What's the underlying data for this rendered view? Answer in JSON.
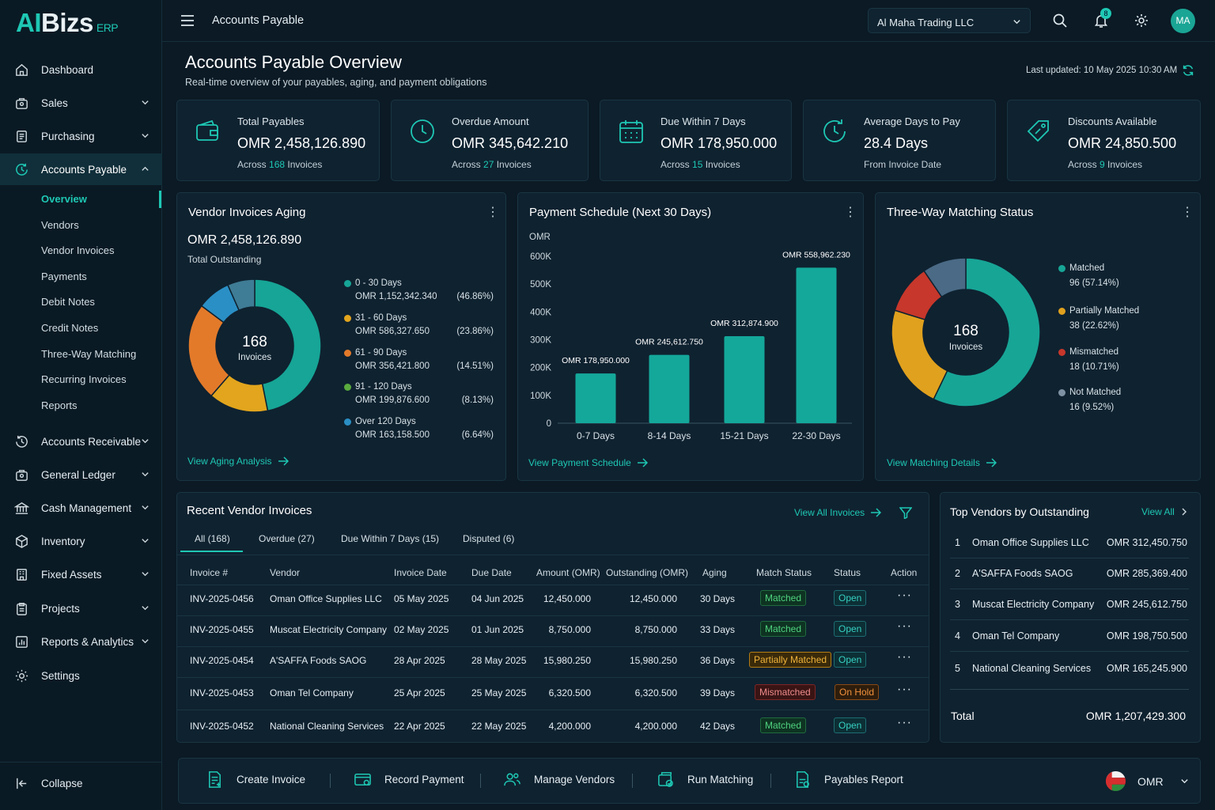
{
  "brand": {
    "logo_ai": "AI",
    "logo_biz": "Bizs",
    "logo_erp": "ERP"
  },
  "sidebar": {
    "items": [
      {
        "label": "Dashboard"
      },
      {
        "label": "Sales"
      },
      {
        "label": "Purchasing"
      },
      {
        "label": "Accounts Payable"
      },
      {
        "label": "Accounts Receivable"
      },
      {
        "label": "General Ledger"
      },
      {
        "label": "Cash Management"
      },
      {
        "label": "Inventory"
      },
      {
        "label": "Fixed Assets"
      },
      {
        "label": "Projects"
      },
      {
        "label": "Reports & Analytics"
      },
      {
        "label": "Settings"
      }
    ],
    "sub_items": [
      "Overview",
      "Vendors",
      "Vendor Invoices",
      "Payments",
      "Debit Notes",
      "Credit Notes",
      "Three-Way Matching",
      "Recurring Invoices",
      "Reports"
    ],
    "collapse": "Collapse"
  },
  "topbar": {
    "title": "Accounts Payable",
    "company": "Al Maha Trading LLC",
    "notif_count": "8",
    "avatar": "MA"
  },
  "page": {
    "title": "Accounts Payable Overview",
    "subtitle": "Real-time overview of your payables, aging, and payment obligations",
    "last_updated": "Last updated: 10 May 2025 10:30 AM"
  },
  "kpis": [
    {
      "label": "Total Payables",
      "value": "OMR 2,458,126.890",
      "sub_pre": "Across ",
      "sub_num": "168",
      "sub_post": " Invoices"
    },
    {
      "label": "Overdue Amount",
      "value": "OMR 345,642.210",
      "sub_pre": "Across ",
      "sub_num": "27",
      "sub_post": " Invoices"
    },
    {
      "label": "Due Within 7 Days",
      "value": "OMR 178,950.000",
      "sub_pre": "Across ",
      "sub_num": "15",
      "sub_post": " Invoices"
    },
    {
      "label": "Average Days to Pay",
      "value": "28.4 Days",
      "sub_pre": "From Invoice Date",
      "sub_num": "",
      "sub_post": ""
    },
    {
      "label": "Discounts Available",
      "value": "OMR 24,850.500",
      "sub_pre": "Across ",
      "sub_num": "9",
      "sub_post": " Invoices"
    }
  ],
  "aging": {
    "title": "Vendor Invoices Aging",
    "total": "OMR 2,458,126.890",
    "total_label": "Total Outstanding",
    "center_num": "168",
    "center_label": "Invoices",
    "link": "View Aging Analysis",
    "buckets": [
      {
        "label": "0 - 30 Days",
        "amount": "OMR 1,152,342.340",
        "pct": "(46.86%)",
        "share": 46.86,
        "color": "#16a596"
      },
      {
        "label": "31 - 60 Days",
        "amount": "OMR 586,327.650",
        "pct": "(23.86%)",
        "share": 23.86,
        "color": "#e37a2a"
      },
      {
        "label": "61 - 90 Days",
        "amount": "OMR 356,421.800",
        "pct": "(14.51%)",
        "share": 14.51,
        "color": "#e2a51d"
      },
      {
        "label": "91 - 120 Days",
        "amount": "OMR 199,876.600",
        "pct": "(8.13%)",
        "share": 8.13,
        "color": "#2a8fc5"
      },
      {
        "label": "Over 120 Days",
        "amount": "OMR 163,158.500",
        "pct": "(6.64%)",
        "share": 6.64,
        "color": "#3f7c95"
      }
    ]
  },
  "chart_data": {
    "type": "bar",
    "title": "Payment Schedule (Next 30 Days)",
    "ylabel": "OMR",
    "xlabel": "",
    "categories": [
      "0-7 Days",
      "8-14 Days",
      "15-21 Days",
      "22-30 Days"
    ],
    "values": [
      178950.0,
      245612.75,
      312874.9,
      558962.23
    ],
    "data_labels": [
      "OMR 178,950.000",
      "OMR 245,612.750",
      "OMR 312,874.900",
      "OMR 558,962.230"
    ],
    "ylim": [
      0,
      600000
    ],
    "y_ticks": [
      0,
      100000,
      200000,
      300000,
      400000,
      500000,
      600000
    ],
    "y_tick_labels": [
      "0",
      "100K",
      "200K",
      "300K",
      "400K",
      "500K",
      "600K"
    ],
    "grid": false,
    "color": "#14a89a"
  },
  "schedule": {
    "title_main": "Payment Schedule",
    "title_sub": " (Next 30 Days)",
    "link": "View Payment Schedule"
  },
  "matching": {
    "title": "Three-Way Matching Status",
    "center_num": "168",
    "center_label": "Invoices",
    "link": "View Matching Details",
    "statuses": [
      {
        "label": "Matched",
        "value": "96 (57.14%)",
        "share": 57.14,
        "color": "#17a596"
      },
      {
        "label": "Partially Matched",
        "value": "38 (22.62%)",
        "share": 22.62,
        "color": "#e0a11e"
      },
      {
        "label": "Mismatched",
        "value": "18 (10.71%)",
        "share": 10.71,
        "color": "#c7372b"
      },
      {
        "label": "Not Matched",
        "value": "16 (9.52%)",
        "share": 9.52,
        "color": "#4a6a86"
      }
    ]
  },
  "invoices": {
    "title": "Recent Vendor Invoices",
    "view_all": "View All Invoices",
    "tabs": [
      "All (168)",
      "Overdue (27)",
      "Due Within 7 Days (15)",
      "Disputed (6)"
    ],
    "headers": [
      "Invoice #",
      "Vendor",
      "Invoice Date",
      "Due Date",
      "Amount (OMR)",
      "Outstanding (OMR)",
      "Aging",
      "Match Status",
      "Status",
      "Action"
    ],
    "rows": [
      {
        "id": "INV-2025-0456",
        "vendor": "Oman Office Supplies LLC",
        "inv_date": "05 May 2025",
        "due": "04 Jun 2025",
        "amount": "12,450.000",
        "outstanding": "12,450.000",
        "aging": "30 Days",
        "match": "Matched",
        "match_type": "ok",
        "status": "Open",
        "status_type": "open"
      },
      {
        "id": "INV-2025-0455",
        "vendor": "Muscat Electricity Company",
        "inv_date": "02 May 2025",
        "due": "01 Jun 2025",
        "amount": "8,750.000",
        "outstanding": "8,750.000",
        "aging": "33 Days",
        "match": "Matched",
        "match_type": "ok",
        "status": "Open",
        "status_type": "open"
      },
      {
        "id": "INV-2025-0454",
        "vendor": "A'SAFFA Foods SAOG",
        "inv_date": "28 Apr 2025",
        "due": "28 May 2025",
        "amount": "15,980.250",
        "outstanding": "15,980.250",
        "aging": "36 Days",
        "match": "Partially Matched",
        "match_type": "partial",
        "status": "Open",
        "status_type": "open"
      },
      {
        "id": "INV-2025-0453",
        "vendor": "Oman Tel Company",
        "inv_date": "25 Apr 2025",
        "due": "25 May 2025",
        "amount": "6,320.500",
        "outstanding": "6,320.500",
        "aging": "39 Days",
        "match": "Mismatched",
        "match_type": "bad",
        "status": "On Hold",
        "status_type": "hold"
      },
      {
        "id": "INV-2025-0452",
        "vendor": "National Cleaning Services",
        "inv_date": "22 Apr 2025",
        "due": "22 May 2025",
        "amount": "4,200.000",
        "outstanding": "4,200.000",
        "aging": "42 Days",
        "match": "Matched",
        "match_type": "ok",
        "status": "Open",
        "status_type": "open"
      }
    ]
  },
  "top_vendors": {
    "title": "Top Vendors by Outstanding",
    "view_all": "View All",
    "rows": [
      {
        "rank": "1",
        "name": "Oman Office Supplies LLC",
        "amount": "OMR 312,450.750"
      },
      {
        "rank": "2",
        "name": "A'SAFFA Foods SAOG",
        "amount": "OMR 285,369.400"
      },
      {
        "rank": "3",
        "name": "Muscat Electricity Company",
        "amount": "OMR 245,612.750"
      },
      {
        "rank": "4",
        "name": "Oman Tel Company",
        "amount": "OMR 198,750.500"
      },
      {
        "rank": "5",
        "name": "National Cleaning Services",
        "amount": "OMR 165,245.900"
      }
    ],
    "total_label": "Total",
    "total_value": "OMR 1,207,429.300"
  },
  "quick_actions": [
    "Create Invoice",
    "Record Payment",
    "Manage Vendors",
    "Run Matching",
    "Payables Report"
  ],
  "currency": "OMR"
}
